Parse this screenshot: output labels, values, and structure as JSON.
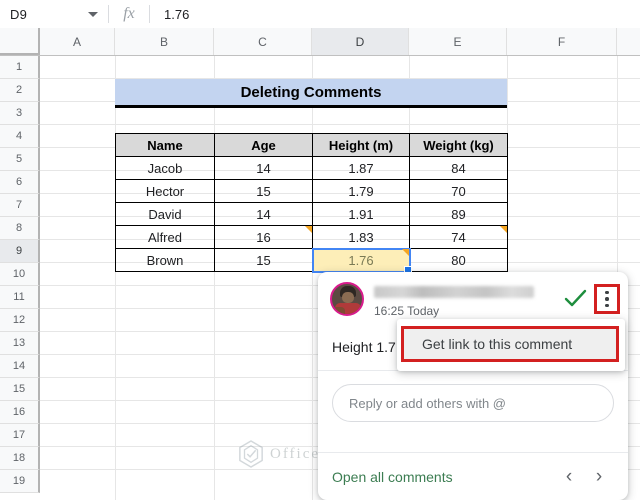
{
  "formula_bar": {
    "name_box": "D9",
    "fx_label": "fx",
    "value": "1.76"
  },
  "grid": {
    "columns": [
      "A",
      "B",
      "C",
      "D",
      "E",
      "F"
    ],
    "selected_column": "D",
    "rows": [
      "1",
      "2",
      "3",
      "4",
      "5",
      "6",
      "7",
      "8",
      "9",
      "10",
      "11",
      "12",
      "13",
      "14",
      "15",
      "16",
      "17",
      "18",
      "19"
    ],
    "selected_row": "9"
  },
  "sheet": {
    "title": "Deleting Comments",
    "table": {
      "headers": [
        "Name",
        "Age",
        "Height (m)",
        "Weight (kg)"
      ],
      "rows": [
        [
          "Jacob",
          "14",
          "1.87",
          "84"
        ],
        [
          "Hector",
          "15",
          "1.79",
          "70"
        ],
        [
          "David",
          "14",
          "1.91",
          "89"
        ],
        [
          "Alfred",
          "16",
          "1.83",
          "74"
        ],
        [
          "Brown",
          "15",
          "1.76",
          "80"
        ]
      ]
    }
  },
  "comment": {
    "author_name": "",
    "timestamp": "16:25 Today",
    "text": "Height 1.7",
    "reply_placeholder": "Reply or add others with @",
    "open_all_label": "Open all comments",
    "prev_arrow": "‹",
    "next_arrow": "›",
    "resolve_icon": "check-icon",
    "more_icon": "kebab-icon"
  },
  "menu": {
    "items": [
      "Get link to this comment"
    ]
  },
  "watermark": {
    "text": "OfficeWheel"
  },
  "colors": {
    "accent_blue": "#4285f4",
    "title_fill": "#c3d4f0",
    "header_fill": "#d9d9d9",
    "selected_cell_fill": "#fdeeb8",
    "comment_marker": "#f5a623",
    "highlight_red": "#d32020",
    "resolve_green": "#1e8e3e",
    "link_green": "#3c7d52"
  }
}
